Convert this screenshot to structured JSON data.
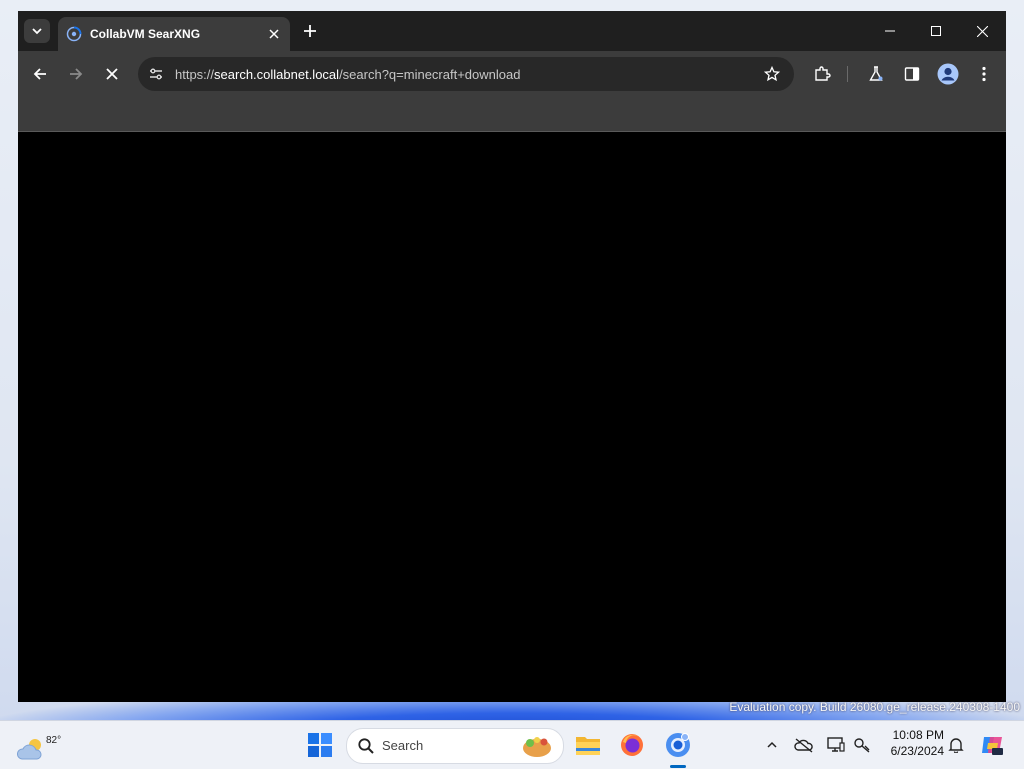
{
  "browser": {
    "tab": {
      "title": "CollabVM SearXNG"
    },
    "omnibox": {
      "url_scheme": "https://",
      "url_host": "search.collabnet.local",
      "url_path": "/search?q=minecraft+download"
    },
    "icons": {
      "tab_search": "chevron-down-icon",
      "tab_favicon": "globe-spinner-icon",
      "tab_close": "close-icon",
      "new_tab": "plus-icon",
      "minimize": "minimize-icon",
      "maximize": "maximize-icon",
      "close_window": "close-icon",
      "back": "arrow-left-icon",
      "forward": "arrow-right-icon",
      "stop": "close-icon",
      "site_info": "tune-icon",
      "bookmark": "star-icon",
      "extensions": "puzzle-icon",
      "labs": "flask-icon",
      "side_panel": "side-panel-icon",
      "profile": "avatar-icon",
      "menu": "kebab-menu-icon"
    },
    "colors": {
      "titlebar": "#1f1f1f",
      "toolbar": "#3c3c3c",
      "omnibox": "#282828",
      "content": "#000000"
    }
  },
  "watermark": {
    "text": "Evaluation copy. Build 26080.ge_release.240308-1400"
  },
  "taskbar": {
    "weather": {
      "temperature": "82°"
    },
    "search": {
      "label": "Search"
    },
    "apps": [
      "start-icon",
      "file-explorer-icon",
      "firefox-icon",
      "chrome-icon"
    ],
    "tray_icons": [
      "chevron-up-icon",
      "cloud-offline-icon",
      "display-icon",
      "network-icon",
      "bell-icon",
      "copilot-icon"
    ],
    "clock": {
      "time": "10:08 PM",
      "date": "6/23/2024"
    }
  }
}
